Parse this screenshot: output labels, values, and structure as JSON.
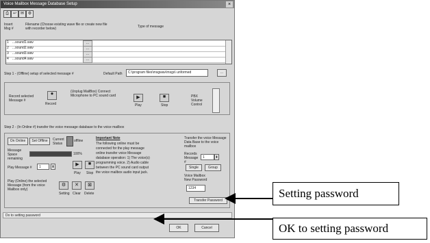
{
  "window": {
    "title": "Voice Mailbox Message Database Setup",
    "close_label": "×"
  },
  "toolbar": {
    "buttons": [
      "⎙",
      "↩",
      "✉",
      "⚙"
    ]
  },
  "columns": {
    "col1": "Insert Msg #",
    "col2": "Filename (Choose existing wave file or create new file with recorder below)",
    "col3": "Type of message"
  },
  "grid": {
    "rows": [
      {
        "num": "1",
        "label": "...sound1.wav"
      },
      {
        "num": "2",
        "label": "...sound2.wav"
      },
      {
        "num": "3",
        "label": "...sound3.wav"
      },
      {
        "num": "4",
        "label": "...sound4.wav"
      }
    ],
    "row_button": "..."
  },
  "path": {
    "step_label": "Step 1 - (Offline) setup of selected message #",
    "default_label": "Default Path",
    "path_value": "C:\\program files\\msgwav\\msgs\\ unformed",
    "browse_label": "..."
  },
  "record": {
    "label": "Record selected Message #",
    "button": "Record",
    "unplug_text": "(Unplug MailBox) Connect Microphone to PC sound card",
    "play_label": "Play",
    "stop_label": "Stop",
    "volume_label": "PBX Volume Control"
  },
  "step2": {
    "label": "Step 2 - (In Online #) transfer the voice message database to the voice mailbox"
  },
  "offline": {
    "on_label": "On Online",
    "offline_label": "Set Offline",
    "status_label": "Current Status",
    "status_value": "offline",
    "memory_label": "Message Space remaining",
    "memory_value": "100%",
    "play_msg_label": "Play Message #",
    "play_msg_value": "1",
    "play_label": "Play",
    "stop_label": "Stop",
    "play_desc": "Play (Online) the selected Message (from the voice Mailbox only)",
    "setting_label": "Setting",
    "clear_label": "Clear",
    "delete_label": "Delete"
  },
  "important": {
    "heading": "Important Note",
    "text": "The following online must be connected for the play message online transfer voice Message database operation: 1) The voice(s) programming voice. 2) Audio cable between the PC sound card output the voice mailbox audio input jack."
  },
  "transfer": {
    "label": "Transfer the voice Message Data Base to the voice mailbox",
    "records_label": "Records Message #",
    "records_value": "1",
    "single_label": "Single",
    "group_label": "Group",
    "password_label": "Voice Mailbox New Password",
    "password_value": "1234",
    "transfer_password_label": "Transfer Password"
  },
  "statusbar": {
    "text": "Do to setting password"
  },
  "dialog_buttons": {
    "ok_label": "OK",
    "cancel_label": "Cancel"
  },
  "callouts": {
    "setting_password": "Setting password",
    "ok_setting_password": "OK to setting password"
  }
}
